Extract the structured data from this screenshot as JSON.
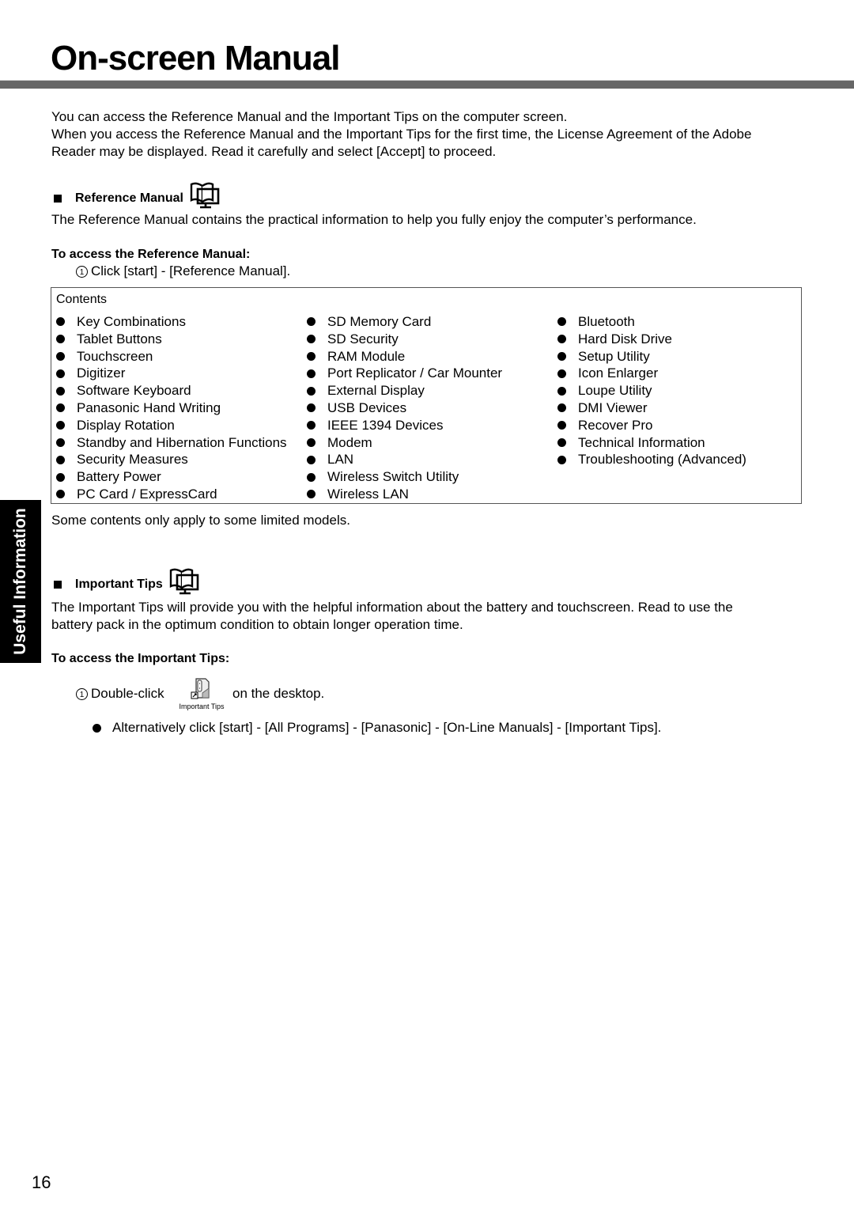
{
  "page": {
    "title": "On-screen Manual",
    "page_number": "16",
    "side_tab": "Useful Information"
  },
  "intro": {
    "line1": "You can access the Reference Manual and the Important Tips on the computer screen.",
    "line2": "When you access the Reference Manual and the Important Tips for the first time, the License Agreement of the Adobe",
    "line3": "Reader may be displayed. Read it carefully and select [Accept] to proceed."
  },
  "reference_manual": {
    "heading": "Reference Manual",
    "icon": "manual-book-monitor-icon",
    "description": "The Reference Manual contains the practical information to help you fully enjoy the computer’s performance.",
    "access_heading": "To access the Reference Manual:",
    "step_number": "1",
    "step": "Click [start] - [Reference Manual].",
    "contents_label": "Contents",
    "contents": {
      "col1": [
        "Key Combinations",
        "Tablet Buttons",
        "Touchscreen",
        "Digitizer",
        "Software Keyboard",
        "Panasonic Hand Writing",
        "Display Rotation",
        "Standby and Hibernation Functions",
        "Security Measures",
        "Battery Power",
        "PC Card / ExpressCard"
      ],
      "col2": [
        "SD Memory Card",
        "SD Security",
        "RAM Module",
        "Port Replicator / Car Mounter",
        "External Display",
        "USB Devices",
        "IEEE 1394 Devices",
        "Modem",
        "LAN",
        "Wireless Switch Utility",
        "Wireless LAN"
      ],
      "col3": [
        "Bluetooth",
        "Hard Disk Drive",
        "Setup Utility",
        "Icon Enlarger",
        "Loupe Utility",
        "DMI Viewer",
        "Recover Pro",
        "Technical Information",
        "Troubleshooting (Advanced)"
      ]
    },
    "note": "Some contents only apply to some limited models."
  },
  "important_tips": {
    "heading": "Important Tips",
    "icon": "manual-book-monitor-icon",
    "description_line1": "The Important Tips will provide you with the helpful information about the battery and touchscreen. Read to use the",
    "description_line2": "battery pack in the optimum condition to obtain longer operation time.",
    "access_heading": "To access the Important Tips:",
    "step_number": "1",
    "step_prefix": "Double-click",
    "step_suffix": "on the desktop.",
    "desktop_icon_caption": "Important Tips",
    "alternative": "Alternatively click [start] - [All Programs] - [Panasonic] - [On-Line Manuals] - [Important Tips]."
  }
}
